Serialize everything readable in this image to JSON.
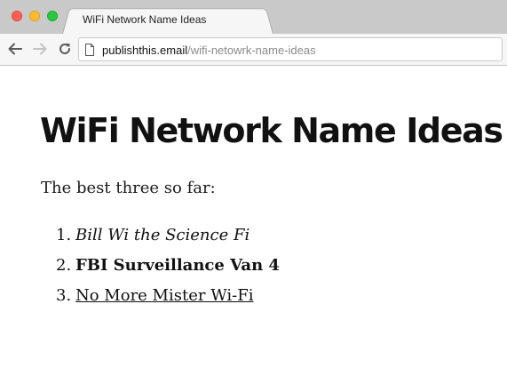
{
  "browser": {
    "tab": {
      "title": "WiFi Network Name Ideas"
    },
    "address_bar": {
      "host": "publishthis.email",
      "path": "/wifi-netowrk-name-ideas"
    }
  },
  "page": {
    "title": "WiFi Network Name Ideas",
    "intro": "The best three so far:",
    "ideas": [
      {
        "number": "1.",
        "text": "Bill Wi the Science Fi",
        "style": "italic"
      },
      {
        "number": "2.",
        "text": "FBI Surveillance Van 4",
        "style": "bold"
      },
      {
        "number": "3.",
        "text": "No More Mister Wi-Fi",
        "style": "underline"
      }
    ]
  },
  "colors": {
    "close": "#fc5f57",
    "minimize": "#fdbc2e",
    "maximize": "#28c840",
    "url_path": "#8a8a8a"
  },
  "icons": {
    "back": "arrow-left-icon",
    "forward": "arrow-right-icon",
    "reload": "reload-icon",
    "page": "page-icon"
  }
}
